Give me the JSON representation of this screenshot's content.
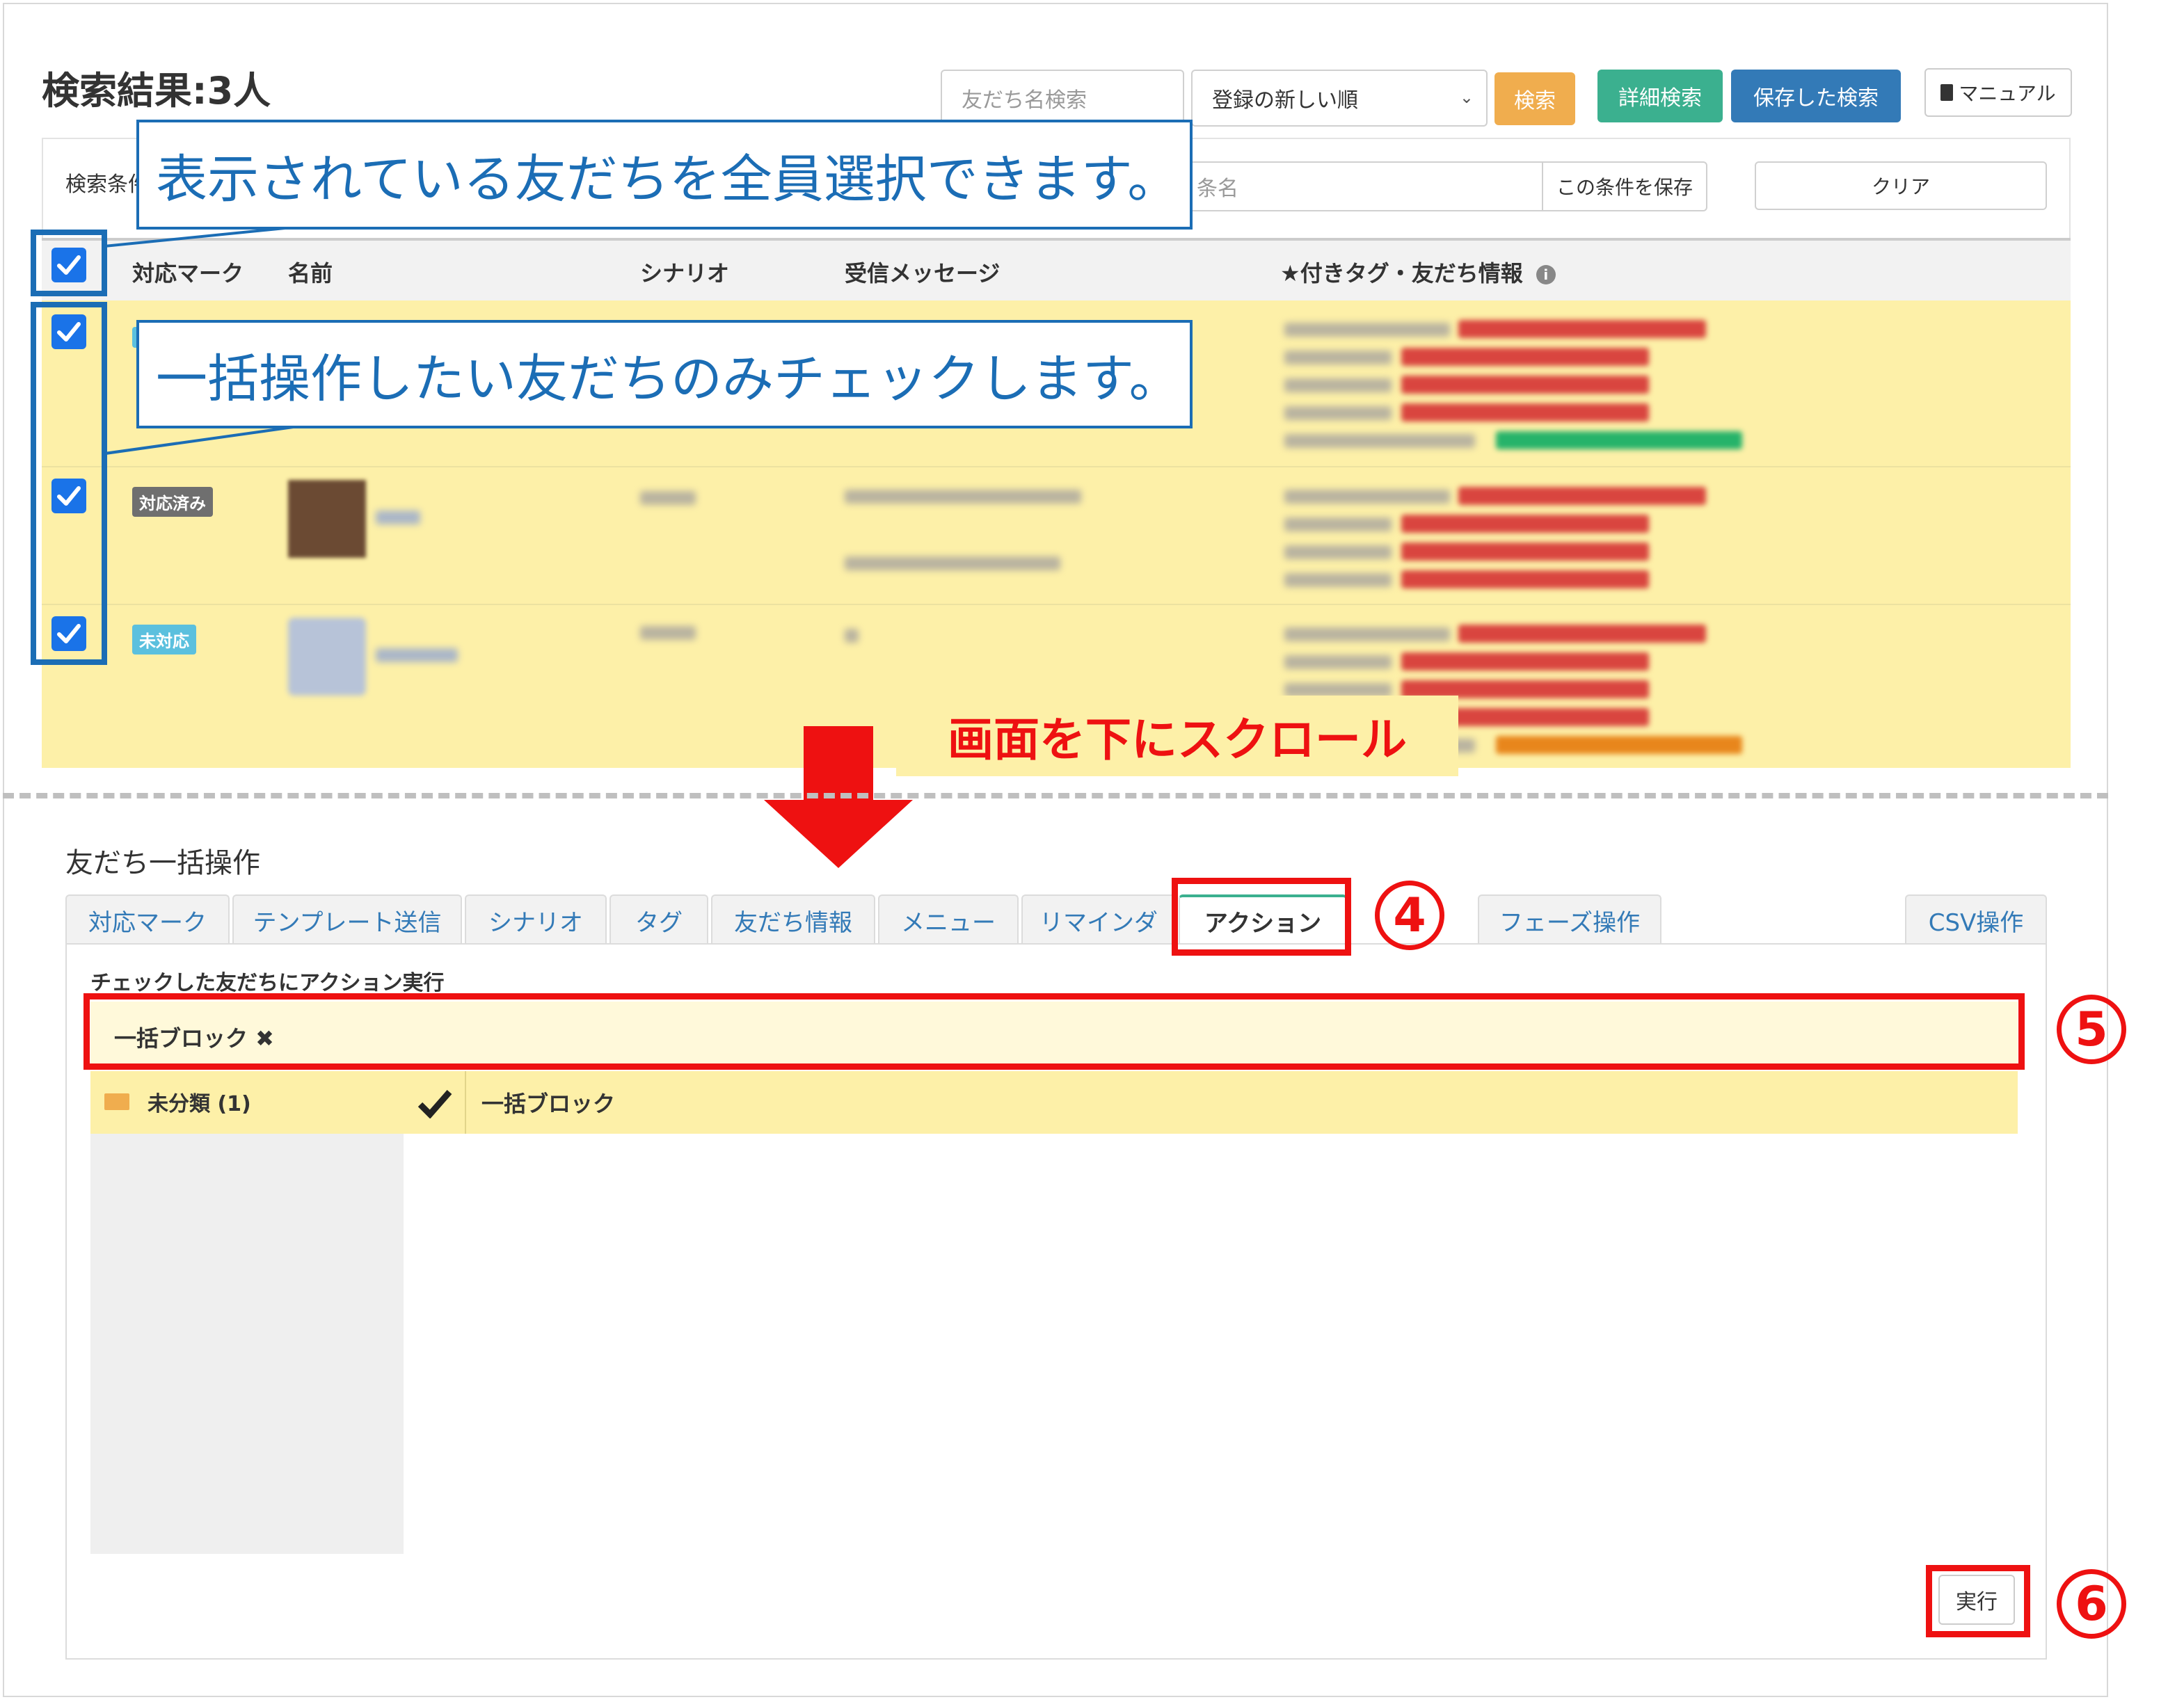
{
  "header": {
    "result_title": "検索結果:3人",
    "search_placeholder": "友だち名検索",
    "sort_value": "登録の新しい順",
    "search_button": "検索",
    "detail_search_button": "詳細検索",
    "saved_search_button": "保存した検索",
    "manual_button": "マニュアル"
  },
  "conditions": {
    "label": "検索条件",
    "name_placeholder": "条名",
    "save_button": "この条件を保存",
    "clear_button": "クリア"
  },
  "table": {
    "columns": [
      "対応マーク",
      "名前",
      "シナリオ",
      "受信メッセージ",
      "★付きタグ・友だち情報"
    ],
    "rows": [
      {
        "mark": "",
        "mark_color": ""
      },
      {
        "mark": "対応済み",
        "mark_color": "#6f6f6f"
      },
      {
        "mark": "未対応",
        "mark_color": "#5bc0de"
      }
    ]
  },
  "callouts": {
    "select_all": "表示されている友だちを全員選択できます。",
    "select_some": "一括操作したい友だちのみチェックします。"
  },
  "scroll_label": "画面を下にスクロール",
  "bulk": {
    "title": "友だち一括操作",
    "tabs": [
      "対応マーク",
      "テンプレート送信",
      "シナリオ",
      "タグ",
      "友だち情報",
      "メニュー",
      "リマインダ",
      "アクション",
      "フェーズ操作",
      "CSV操作"
    ],
    "active_tab": "アクション",
    "section_title": "チェックした友だちにアクション実行",
    "selected_action": "一括ブロック ✖",
    "folder_name": "未分類 (1)",
    "action_name": "一括ブロック",
    "run_button": "実行"
  },
  "steps": [
    "④",
    "⑤",
    "⑥"
  ],
  "colors": {
    "highlight_row": "#fdf0a8",
    "callout_blue": "#1b6db5",
    "annotation_red": "#ee1111",
    "btn_orange": "#f0ad4e",
    "btn_green": "#3bb08f",
    "btn_blue": "#337ab7",
    "checkbox": "#1a73e8"
  },
  "icons": [
    "check-icon",
    "chevron-down-icon",
    "book-icon",
    "info-icon",
    "folder-icon",
    "checkmark-icon",
    "down-arrow-icon"
  ]
}
